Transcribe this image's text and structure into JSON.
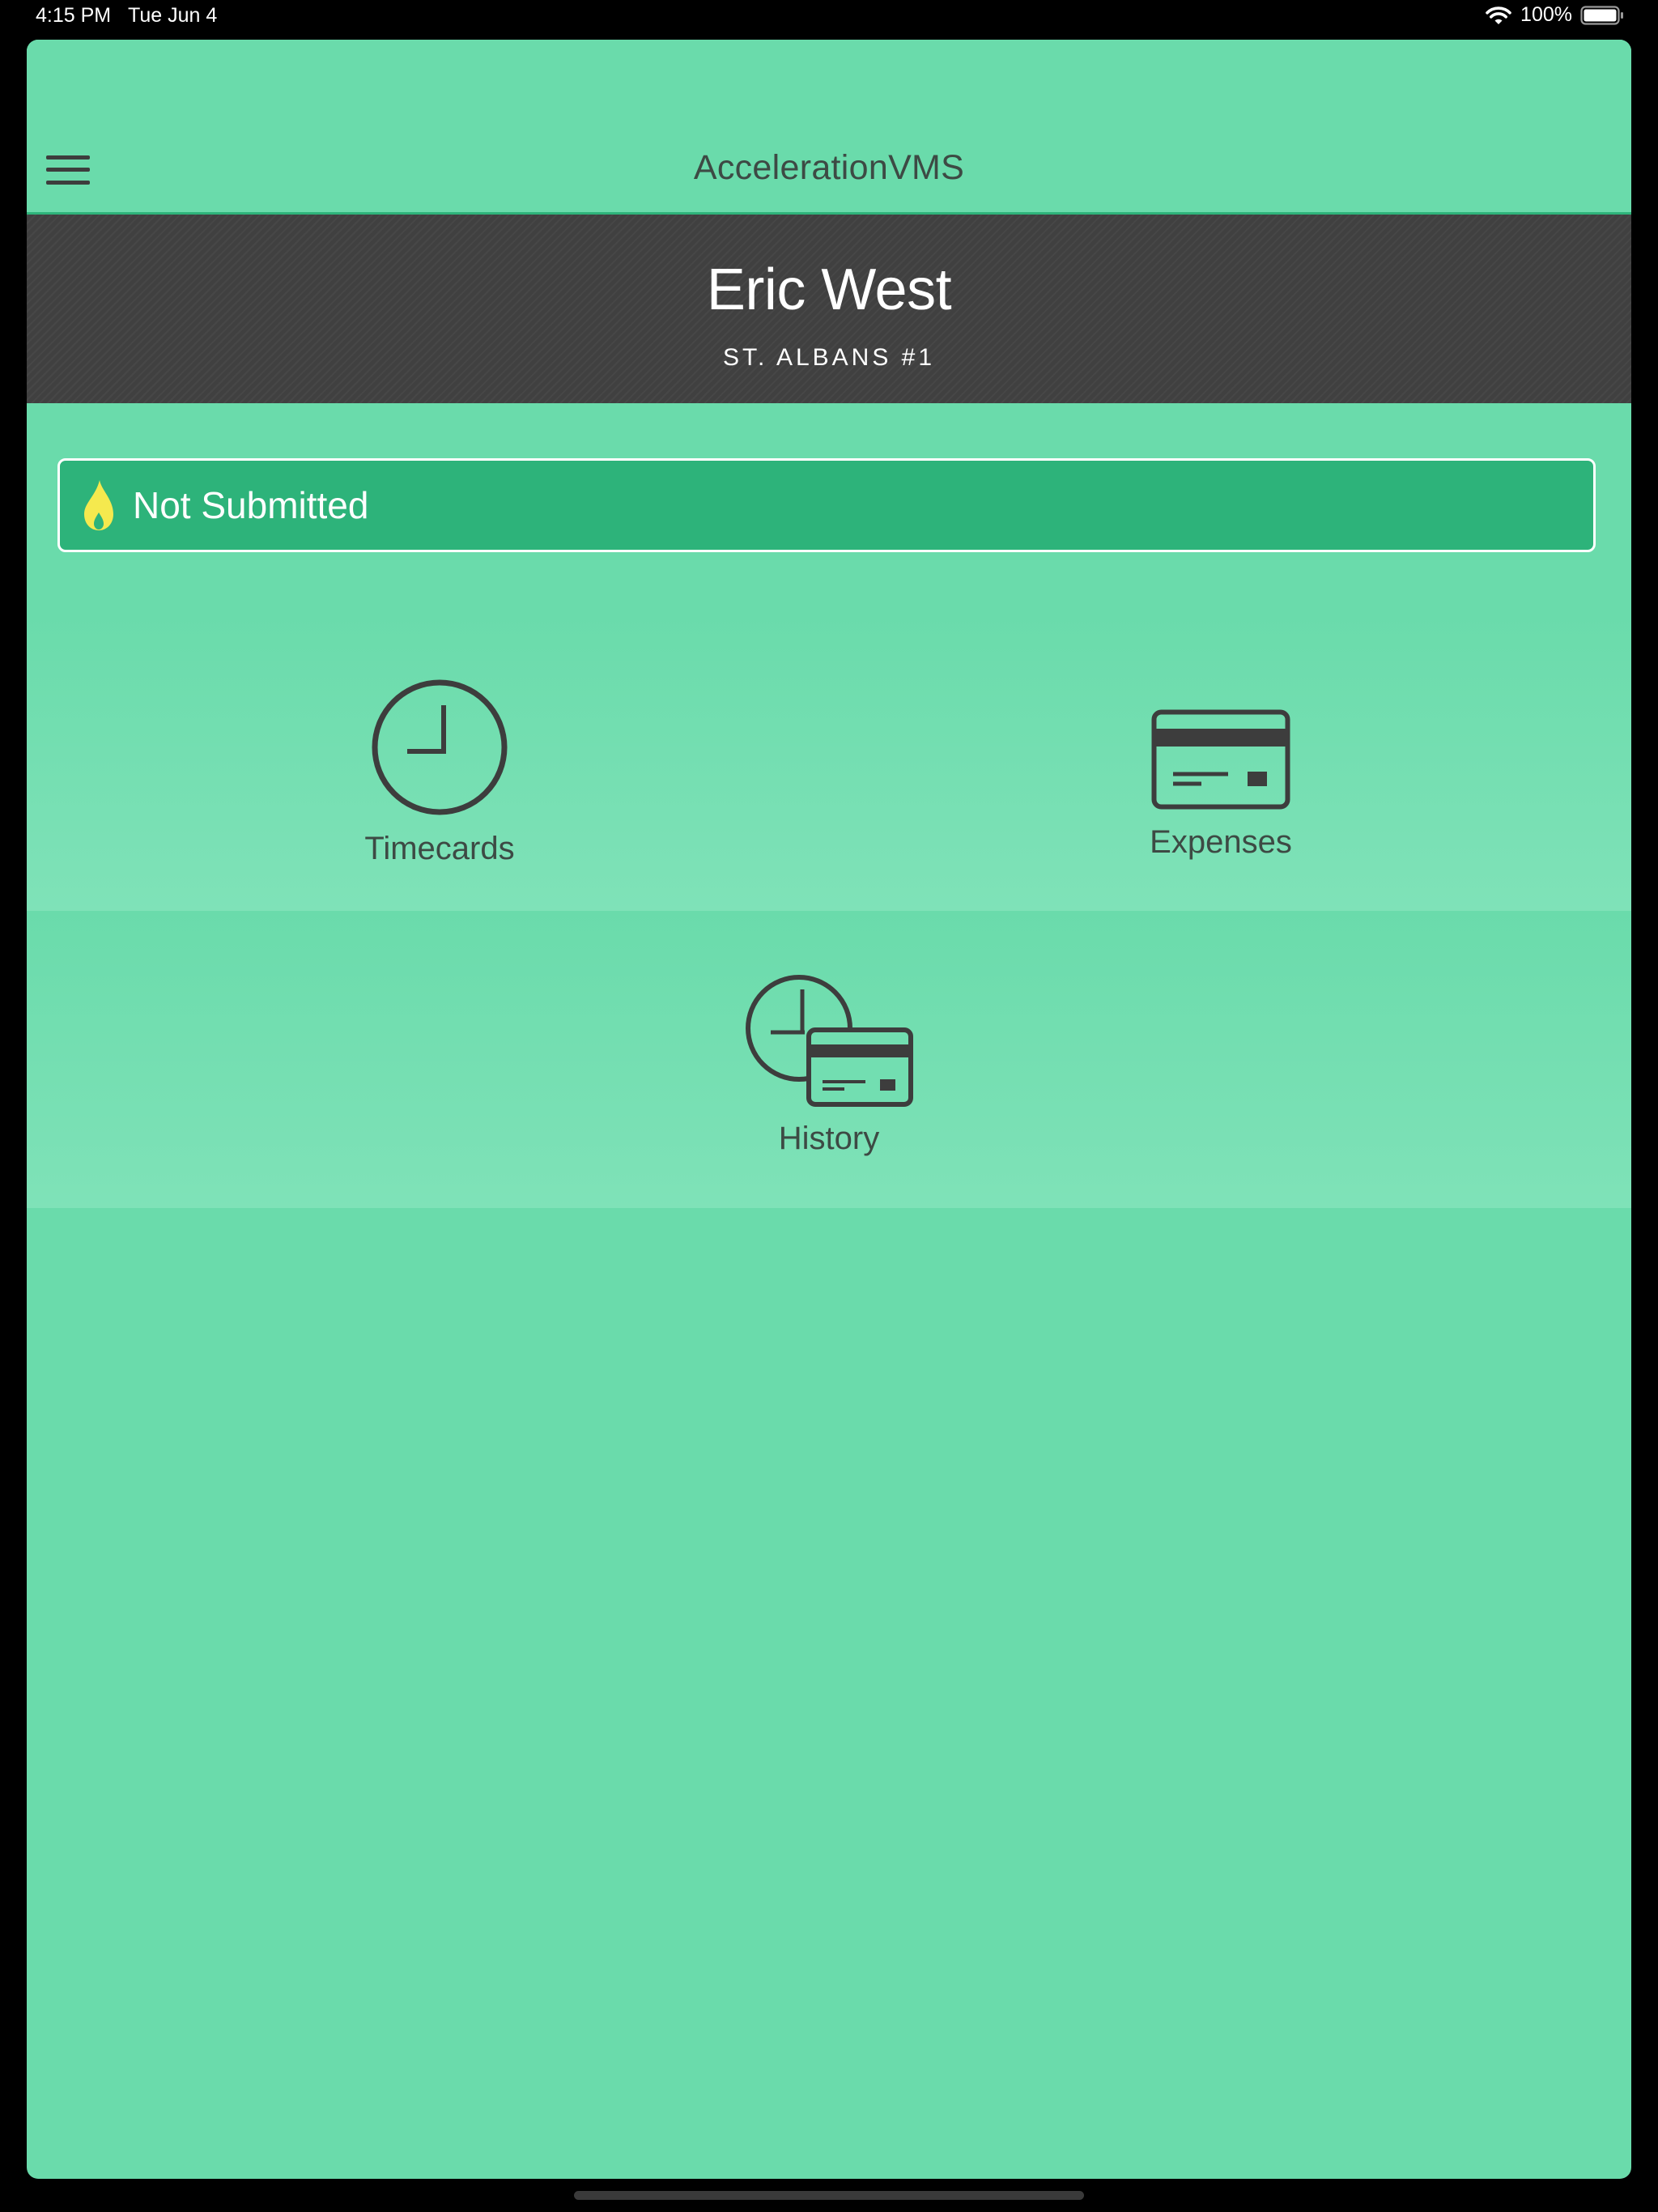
{
  "status_bar": {
    "time": "4:15 PM",
    "date": "Tue Jun 4",
    "battery": "100%",
    "icons": [
      "wifi-icon",
      "battery-icon"
    ]
  },
  "nav": {
    "title": "AccelerationVMS",
    "menu_icon": "hamburger-menu-icon"
  },
  "user": {
    "name": "Eric West",
    "location": "ST. ALBANS #1"
  },
  "submission_status": {
    "label": "Not Submitted",
    "icon": "flame-icon",
    "icon_color": "#f5e94e"
  },
  "tiles": [
    {
      "label": "Timecards",
      "icon": "clock-icon"
    },
    {
      "label": "Expenses",
      "icon": "credit-card-icon"
    },
    {
      "label": "History",
      "icon": "clock-card-icon"
    }
  ],
  "colors": {
    "background": "#6adbab",
    "status_panel": "#2db37a",
    "banner": "#404040",
    "icon": "#3d3d3d"
  }
}
